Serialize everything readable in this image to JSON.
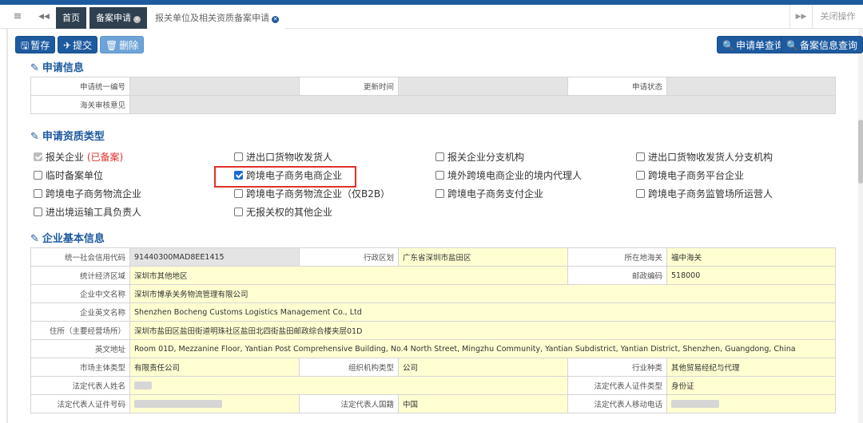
{
  "tabbar": {
    "menu_icon": "≡",
    "back_icon": "◀◀",
    "tabs": [
      {
        "label": "首页"
      },
      {
        "label": "备案申请",
        "close": "✕"
      },
      {
        "label": "报关单位及相关资质备案申请",
        "close": "✕"
      }
    ],
    "forward_icon": "▶▶",
    "close_ops": "关闭操作"
  },
  "toolbar": {
    "save": "暂存",
    "submit": "提交",
    "delete": "删除",
    "query_app": "申请单查询",
    "query_record": "备案信息查询"
  },
  "section1": {
    "title": "申请信息",
    "labels": {
      "unified_no": "申请统一编号",
      "updated_time": "更新时间",
      "status": "申请状态",
      "customs_review": "海关审核意见"
    }
  },
  "section2": {
    "title": "申请资质类型",
    "options": [
      {
        "label": "报关企业",
        "tag": "(已备案)",
        "state": "disabled-checked"
      },
      {
        "label": "进出口货物收发货人",
        "state": "unchecked"
      },
      {
        "label": "报关企业分支机构",
        "state": "unchecked"
      },
      {
        "label": "进出口货物收发货人分支机构",
        "state": "unchecked"
      },
      {
        "label": "临时备案单位",
        "state": "unchecked"
      },
      {
        "label": "跨境电子商务电商企业",
        "state": "checked"
      },
      {
        "label": "境外跨境电商企业的境内代理人",
        "state": "unchecked"
      },
      {
        "label": "跨境电子商务平台企业",
        "state": "unchecked"
      },
      {
        "label": "跨境电子商务物流企业",
        "state": "unchecked"
      },
      {
        "label": "跨境电子商务物流企业（仅B2B）",
        "state": "unchecked"
      },
      {
        "label": "跨境电子商务支付企业",
        "state": "unchecked"
      },
      {
        "label": "跨境电子商务监管场所运营人",
        "state": "unchecked"
      },
      {
        "label": "进出境运输工具负责人",
        "state": "unchecked"
      },
      {
        "label": "无报关权的其他企业",
        "state": "unchecked"
      }
    ]
  },
  "section3": {
    "title": "企业基本信息",
    "credit_code_label": "统一社会信用代码",
    "credit_code": "91440300MAD8EE1415",
    "admin_region_label": "行政区划",
    "admin_region": "广东省深圳市盐田区",
    "customs_label": "所在地海关",
    "customs": "福中海关",
    "econ_zone_label": "统计经济区域",
    "econ_zone": "深圳市其他地区",
    "postal_label": "邮政编码",
    "postal": "518000",
    "cn_name_label": "企业中文名称",
    "cn_name": "深圳市博承关务物流管理有限公司",
    "en_name_label": "企业英文名称",
    "en_name": "Shenzhen Bocheng Customs Logistics Management Co., Ltd",
    "address_label": "住所（主要经营场所）",
    "address": "深圳市盐田区盐田街道明珠社区盐田北四街盐田邮政综合楼夹层01D",
    "en_address_label": "英文地址",
    "en_address": "Room 01D, Mezzanine Floor, Yantian Post Comprehensive Building, No.4 North Street, Mingzhu Community, Yantian Subdistrict, Yantian District, Shenzhen, Guangdong, China",
    "market_type_label": "市场主体类型",
    "market_type": "有限责任公司",
    "org_type_label": "组织机构类型",
    "org_type": "公司",
    "industry_label": "行业种类",
    "industry": "其他贸易经纪与代理",
    "legal_rep_label": "法定代表人姓名",
    "legal_id_type_label": "法定代表人证件类型",
    "legal_id_type": "身份证",
    "legal_id_no_label": "法定代表人证件号码",
    "legal_nation_label": "法定代表人国籍",
    "legal_nation": "中国",
    "legal_mobile_label": "法定代表人移动电话"
  },
  "colors": {
    "primary": "#1d5aa0",
    "highlight": "#e0312b",
    "field_yellow": "#ffffd2"
  }
}
